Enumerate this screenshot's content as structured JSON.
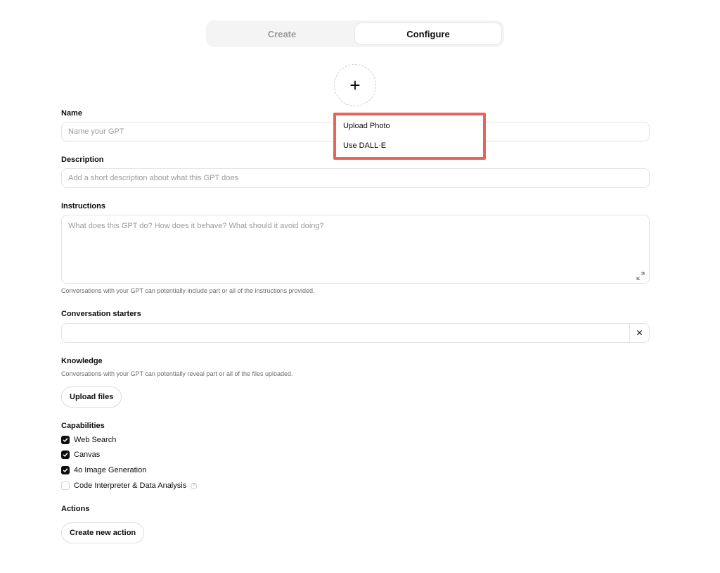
{
  "tabs": [
    {
      "label": "Create",
      "active": false
    },
    {
      "label": "Configure",
      "active": true
    }
  ],
  "avatar": {
    "add_glyph": "+",
    "icon": "plus-icon"
  },
  "menu": {
    "items": [
      "Upload Photo",
      "Use DALL·E"
    ],
    "highlight_color": "#e8645a"
  },
  "name": {
    "label": "Name",
    "placeholder": "Name your GPT",
    "value": ""
  },
  "description": {
    "label": "Description",
    "placeholder": "Add a short description about what this GPT does",
    "value": ""
  },
  "instructions": {
    "label": "Instructions",
    "placeholder": "What does this GPT do? How does it behave? What should it avoid doing?",
    "value": "",
    "hint": "Conversations with your GPT can potentially include part or all of the instructions provided."
  },
  "starters": {
    "label": "Conversation starters",
    "value": "",
    "remove_glyph": "✕"
  },
  "knowledge": {
    "label": "Knowledge",
    "hint": "Conversations with your GPT can potentially reveal part or all of the files uploaded.",
    "upload_label": "Upload files"
  },
  "capabilities": {
    "label": "Capabilities",
    "items": [
      {
        "label": "Web Search",
        "checked": true
      },
      {
        "label": "Canvas",
        "checked": true
      },
      {
        "label": "4o Image Generation",
        "checked": true
      },
      {
        "label": "Code Interpreter & Data Analysis",
        "checked": false,
        "help": "?"
      }
    ]
  },
  "actions": {
    "label": "Actions",
    "create_label": "Create new action"
  }
}
